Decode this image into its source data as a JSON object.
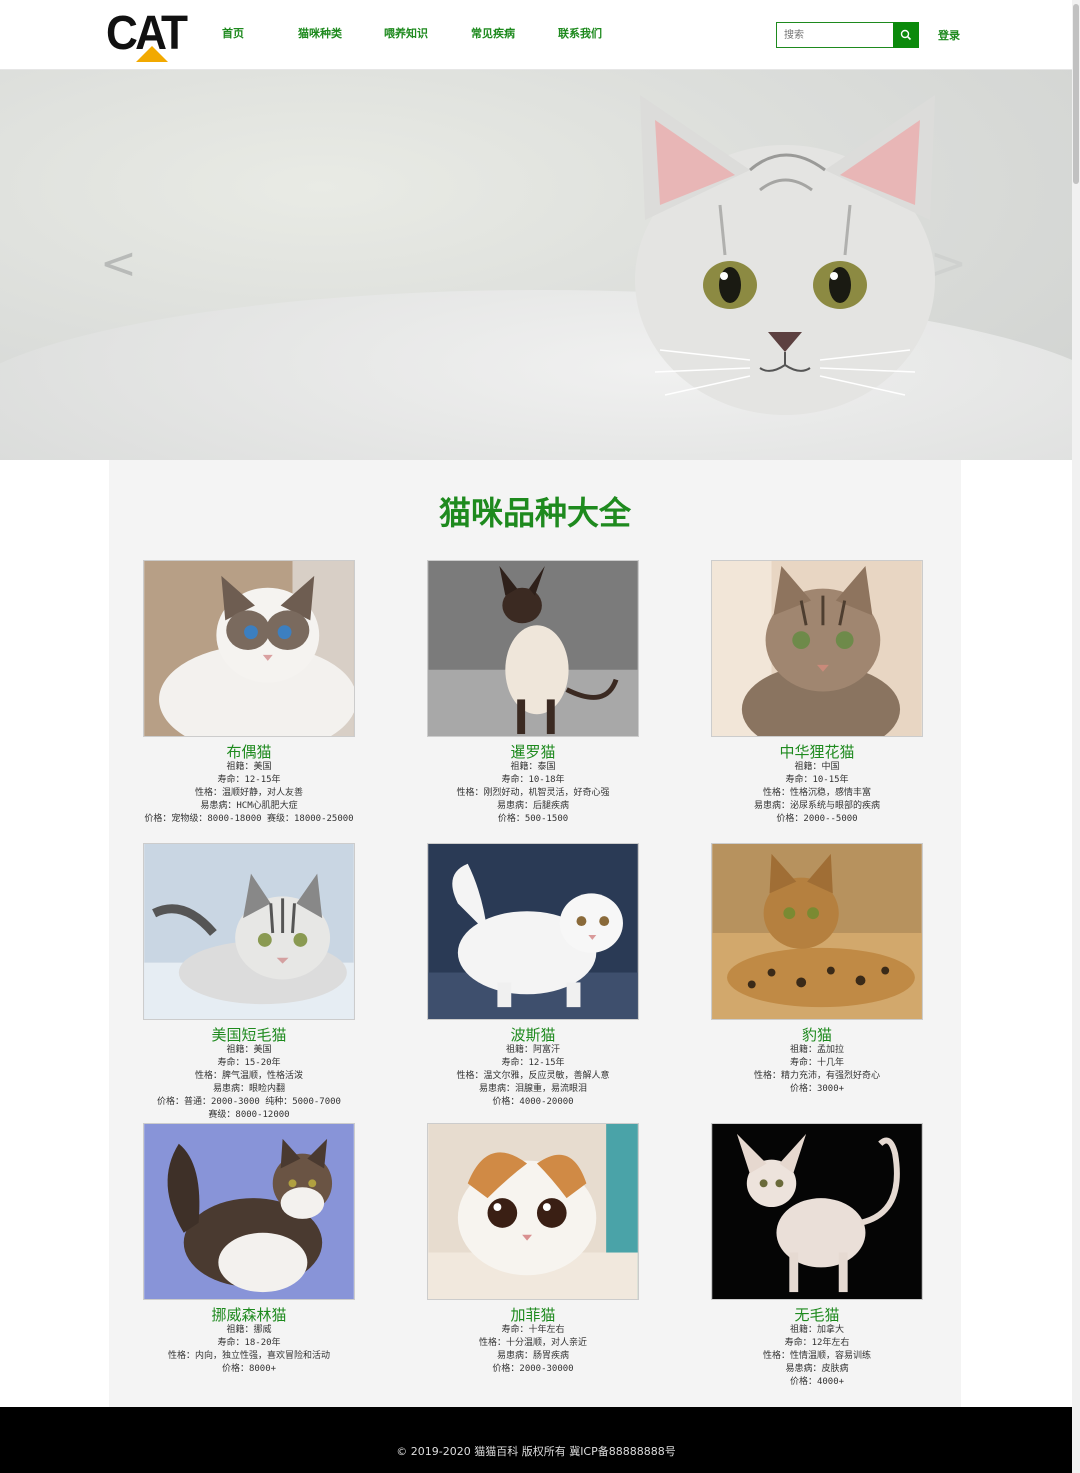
{
  "header": {
    "logo_text": "CAT",
    "nav": [
      "首页",
      "猫咪种类",
      "喂养知识",
      "常见疾病",
      "联系我们"
    ],
    "search_placeholder": "搜索",
    "login_label": "登录"
  },
  "banner": {
    "prev_arrow": "<",
    "next_arrow": ">"
  },
  "section_title": "猫咪品种大全",
  "cats": [
    {
      "name": "布偶猫",
      "lines": [
        "祖籍：美国",
        "寿命：12-15年",
        "性格：温顺好静，对人友善",
        "易患病：HCM心肌肥大症",
        "价格：宠物级：8000-18000 赛级：18000-25000"
      ]
    },
    {
      "name": "暹罗猫",
      "lines": [
        "祖籍：泰国",
        "寿命：10-18年",
        "性格：刚烈好动，机智灵活，好奇心强",
        "易患病：后腿疾病",
        "价格：500-1500"
      ]
    },
    {
      "name": "中华狸花猫",
      "lines": [
        "祖籍：中国",
        "寿命：10-15年",
        "性格：性格沉稳，感情丰富",
        "易患病：泌尿系统与眼部的疾病",
        "价格：2000--5000"
      ]
    },
    {
      "name": "美国短毛猫",
      "lines": [
        "祖籍：美国",
        "寿命：15-20年",
        "性格：脾气温顺，性格活泼",
        "易患病：眼睑内翻",
        "价格：普通：2000-3000 纯种：5000-7000",
        "赛级：8000-12000"
      ]
    },
    {
      "name": "波斯猫",
      "lines": [
        "祖籍：阿富汗",
        "寿命：12-15年",
        "性格：温文尔雅，反应灵敏，善解人意",
        "易患病：泪腺重，易流眼泪",
        "价格：4000-20000"
      ]
    },
    {
      "name": "豹猫",
      "lines": [
        "祖籍：孟加拉",
        "寿命：十几年",
        "性格：精力充沛，有强烈好奇心",
        "价格：3000+"
      ]
    },
    {
      "name": "挪威森林猫",
      "lines": [
        "祖籍：挪威",
        "寿命：18-20年",
        "性格：内向，独立性强，喜欢冒险和活动",
        "价格：8000+"
      ]
    },
    {
      "name": "加菲猫",
      "lines": [
        "寿命：十年左右",
        "性格：十分温顺，对人亲近",
        "易患病：肠胃疾病",
        "价格：2000-30000"
      ]
    },
    {
      "name": "无毛猫",
      "lines": [
        "祖籍：加拿大",
        "寿命：12年左右",
        "性格：性情温顺，容易训练",
        "易患病：皮肤病",
        "价格：4000+"
      ]
    }
  ],
  "footer": {
    "copyright": "© 2019-2020 猫猫百科 版权所有 冀ICP备88888888号"
  },
  "colors": {
    "accent": "#1e8a1e",
    "search_button": "#0b8a0b",
    "footer_bg": "#000000",
    "content_bg": "#f4f4f4"
  }
}
